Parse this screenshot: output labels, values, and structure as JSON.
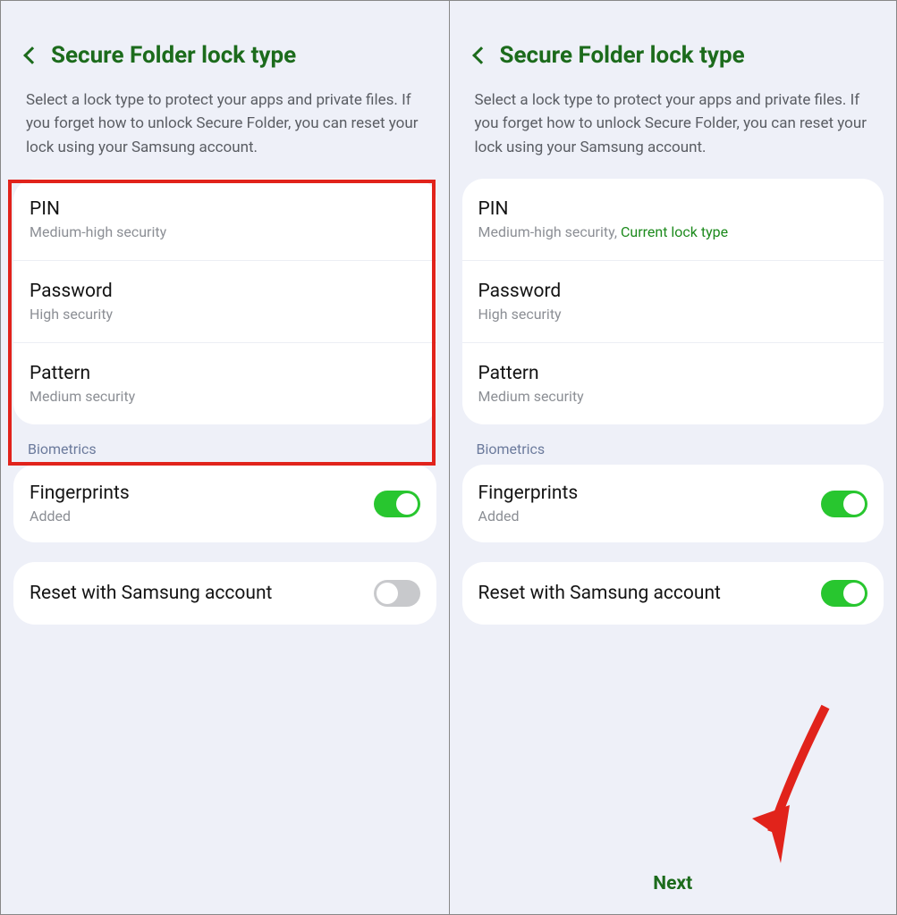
{
  "left": {
    "title": "Secure Folder lock type",
    "description": "Select a lock type to protect your apps and private files. If you forget how to unlock Secure Folder, you can reset your lock using your Samsung account.",
    "lock_types": [
      {
        "title": "PIN",
        "sub": "Medium-high security"
      },
      {
        "title": "Password",
        "sub": "High security"
      },
      {
        "title": "Pattern",
        "sub": "Medium security"
      }
    ],
    "biometrics_label": "Biometrics",
    "fingerprints": {
      "title": "Fingerprints",
      "sub": "Added",
      "on": true
    },
    "reset": {
      "title": "Reset with Samsung account",
      "on": false
    },
    "highlight": true
  },
  "right": {
    "title": "Secure Folder lock type",
    "description": "Select a lock type to protect your apps and private files. If you forget how to unlock Secure Folder, you can reset your lock using your Samsung account.",
    "lock_types": [
      {
        "title": "PIN",
        "sub": "Medium-high security,",
        "extra": "Current lock type"
      },
      {
        "title": "Password",
        "sub": "High security"
      },
      {
        "title": "Pattern",
        "sub": "Medium security"
      }
    ],
    "biometrics_label": "Biometrics",
    "fingerprints": {
      "title": "Fingerprints",
      "sub": "Added",
      "on": true
    },
    "reset": {
      "title": "Reset with Samsung account",
      "on": true
    },
    "next_label": "Next",
    "arrow": true
  }
}
